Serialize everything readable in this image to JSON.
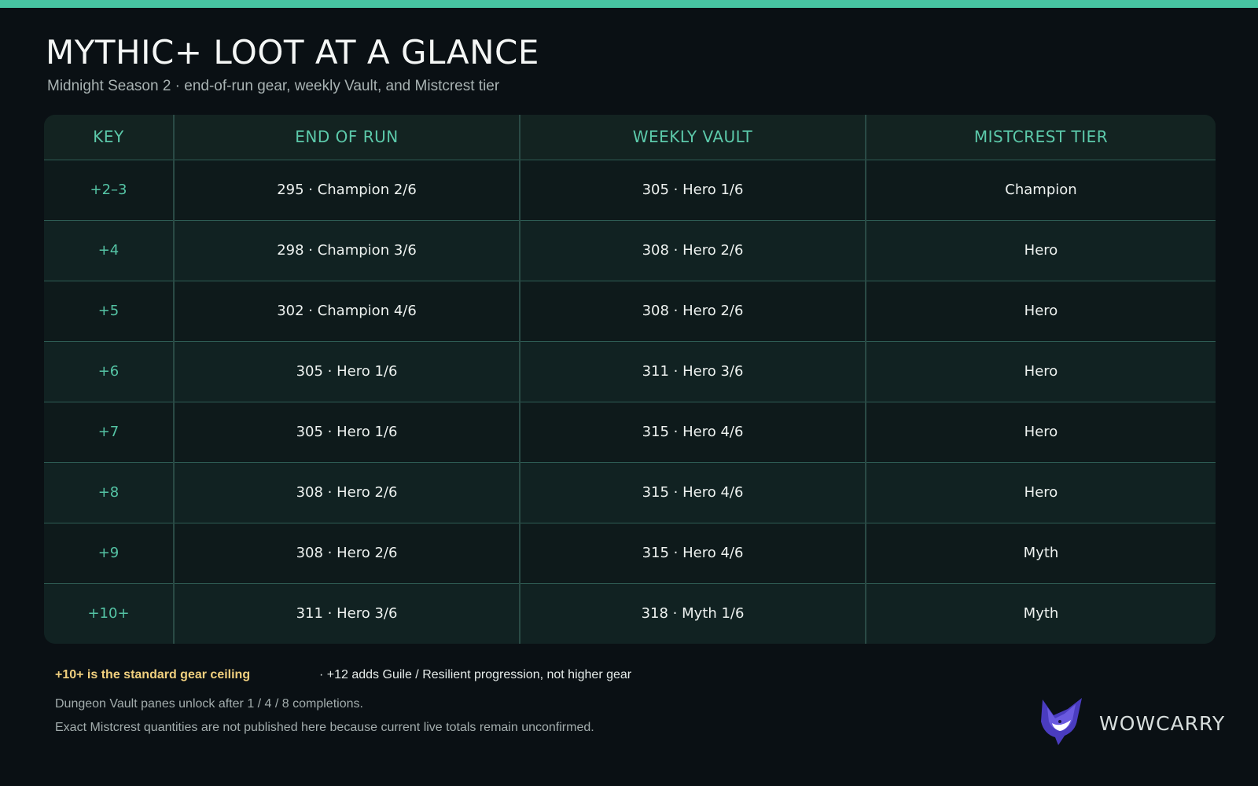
{
  "header": {
    "title": "MYTHIC+ LOOT AT A GLANCE",
    "subtitle": "Midnight Season 2 · end-of-run gear, weekly Vault, and Mistcrest tier"
  },
  "table": {
    "columns": [
      "KEY",
      "END OF RUN",
      "WEEKLY VAULT",
      "MISTCREST TIER"
    ],
    "rows": [
      {
        "key": "+2–3",
        "end_of_run": "295 · Champion 2/6",
        "weekly_vault": "305 · Hero 1/6",
        "tier": "Champion"
      },
      {
        "key": "+4",
        "end_of_run": "298 · Champion 3/6",
        "weekly_vault": "308 · Hero 2/6",
        "tier": "Hero"
      },
      {
        "key": "+5",
        "end_of_run": "302 · Champion 4/6",
        "weekly_vault": "308 · Hero 2/6",
        "tier": "Hero"
      },
      {
        "key": "+6",
        "end_of_run": "305 · Hero 1/6",
        "weekly_vault": "311 · Hero 3/6",
        "tier": "Hero"
      },
      {
        "key": "+7",
        "end_of_run": "305 · Hero 1/6",
        "weekly_vault": "315 · Hero 4/6",
        "tier": "Hero"
      },
      {
        "key": "+8",
        "end_of_run": "308 · Hero 2/6",
        "weekly_vault": "315 · Hero 4/6",
        "tier": "Hero"
      },
      {
        "key": "+9",
        "end_of_run": "308 · Hero 2/6",
        "weekly_vault": "315 · Hero 4/6",
        "tier": "Myth"
      },
      {
        "key": "+10+",
        "end_of_run": "311 · Hero 3/6",
        "weekly_vault": "318 · Myth 1/6",
        "tier": "Myth"
      }
    ]
  },
  "notes": {
    "highlight": "+10+ is the standard gear ceiling",
    "highlight_rest": "· +12 adds Guile / Resilient progression, not higher gear",
    "line2": "Dungeon Vault panes unlock after 1 / 4 / 8 completions.",
    "line3": "Exact Mistcrest quantities are not published here because current live totals remain unconfirmed."
  },
  "brand": {
    "name": "WOWCARRY",
    "logo_icon": "fox-mascot-icon"
  },
  "colors": {
    "accent": "#47c4a2",
    "highlight": "#f0cf7e",
    "background": "#0a1014",
    "logo": "#5a4bd1"
  }
}
